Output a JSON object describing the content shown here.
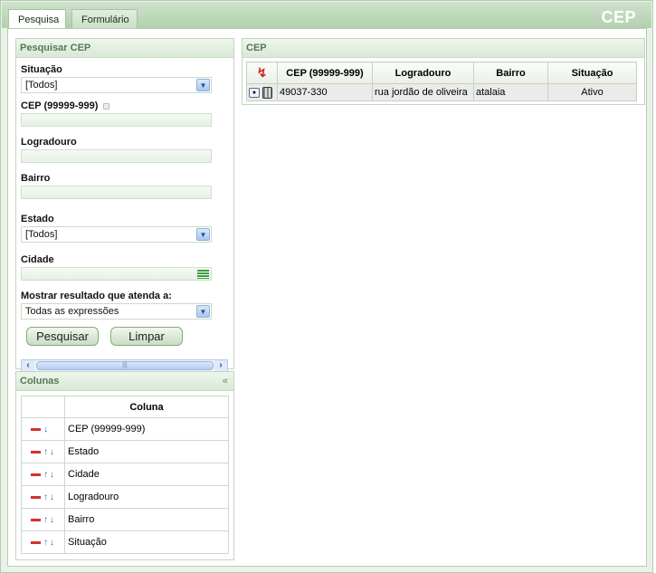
{
  "app": {
    "brand": "CEP"
  },
  "tabs": [
    {
      "label": "Pesquisa"
    },
    {
      "label": "Formulário"
    }
  ],
  "search_panel": {
    "title": "Pesquisar CEP",
    "situacao": {
      "label": "Situação",
      "value": "[Todos]"
    },
    "cep": {
      "label": "CEP (99999-999)",
      "value": ""
    },
    "logradouro": {
      "label": "Logradouro",
      "value": ""
    },
    "bairro": {
      "label": "Bairro",
      "value": ""
    },
    "estado": {
      "label": "Estado",
      "value": "[Todos]"
    },
    "cidade": {
      "label": "Cidade",
      "value": ""
    },
    "mostrar": {
      "label": "Mostrar resultado que atenda a:",
      "value": "Todas as expressões"
    },
    "search_button": "Pesquisar",
    "clear_button": "Limpar"
  },
  "columns_panel": {
    "title": "Colunas",
    "collapse": "«",
    "header": "Coluna",
    "rows": [
      {
        "name": "CEP (99999-999)",
        "up": false
      },
      {
        "name": "Estado",
        "up": true
      },
      {
        "name": "Cidade",
        "up": true
      },
      {
        "name": "Logradouro",
        "up": true
      },
      {
        "name": "Bairro",
        "up": true
      },
      {
        "name": "Situação",
        "up": true
      }
    ]
  },
  "results_panel": {
    "title": "CEP",
    "headers": [
      "CEP (99999-999)",
      "Logradouro",
      "Bairro",
      "Situação"
    ],
    "rows": [
      {
        "cep": "49037-330",
        "logradouro": "rua jordão de oliveira",
        "bairro": "atalaia",
        "situacao": "Ativo"
      }
    ]
  },
  "icons": {
    "pdf": "pdf-icon",
    "view": "view-icon",
    "delete": "trash-icon",
    "lock": "lock-icon",
    "list": "list-icon"
  },
  "colors": {
    "header_green": "#b2d0ad",
    "panel_title": "#557a55",
    "remove_red": "#d2322d"
  }
}
